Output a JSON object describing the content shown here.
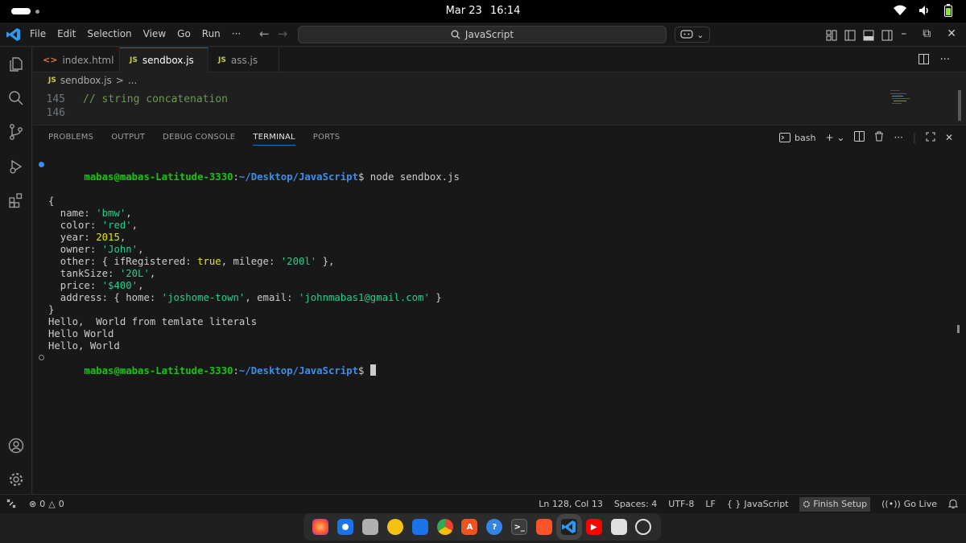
{
  "system_bar": {
    "date": "Mar 23",
    "time": "16:14",
    "tray_icons": [
      "wifi-icon",
      "volume-icon",
      "battery-icon"
    ]
  },
  "titlebar": {
    "menu": [
      "File",
      "Edit",
      "Selection",
      "View",
      "Go",
      "Run",
      "···"
    ],
    "search_text": "JavaScript",
    "accent_color": "#0078d4"
  },
  "tabs": [
    {
      "label": "index.html",
      "icon": "html-icon",
      "active": false
    },
    {
      "label": "sendbox.js",
      "icon": "js-icon",
      "active": true
    },
    {
      "label": "ass.js",
      "icon": "js-icon",
      "active": false
    }
  ],
  "breadcrumb": {
    "icon_label": "JS",
    "file": "sendbox.js",
    "separator": ">",
    "ellipsis": "..."
  },
  "editor": {
    "lines": [
      {
        "number": "145",
        "text": "// string concatenation",
        "type": "comment"
      },
      {
        "number": "146",
        "text": "",
        "type": "plain"
      }
    ]
  },
  "panel": {
    "tabs": [
      "PROBLEMS",
      "OUTPUT",
      "DEBUG CONSOLE",
      "TERMINAL",
      "PORTS"
    ],
    "active_tab": "TERMINAL",
    "shell": "bash",
    "add_label": "+",
    "more_label": "···"
  },
  "terminal": {
    "prompt_user": "mabas@mabas-Latitude-3330",
    "prompt_path": "~/Desktop/JavaScript",
    "prompt_suffix": "$",
    "command": " node sendbox.js",
    "open_brace": "{",
    "close_brace": "}",
    "obj": {
      "name_key": "  name: ",
      "name_val": "'bmw'",
      "color_key": "  color: ",
      "color_val": "'red'",
      "year_key": "  year: ",
      "year_val": "2015",
      "owner_key": "  owner: ",
      "owner_val": "'John'",
      "other_key": "  other: { ifRegistered: ",
      "other_bool": "true",
      "other_mid": ", milege: ",
      "other_val": "'200l'",
      "other_end": " },",
      "tank_key": "  tankSize: ",
      "tank_val": "'20L'",
      "price_key": "  price: ",
      "price_val": "'$400'",
      "addr_key": "  address: { home: ",
      "addr_home": "'joshome-town'",
      "addr_mid": ", email: ",
      "addr_email": "'johnmabas1@gmail.com'",
      "addr_end": " }"
    },
    "comma": ",",
    "output": [
      "Hello,  World from temlate literals",
      "Hello World",
      "Hello, World"
    ],
    "success_dot_color": "#3b8eea",
    "idle_dot_color": "#888888"
  },
  "statusbar": {
    "errors": "0",
    "warnings": "0",
    "position": "Ln 128, Col 13",
    "spaces": "Spaces: 4",
    "encoding": "UTF-8",
    "eol": "LF",
    "language": "JavaScript",
    "language_icon": "{ }",
    "finish_setup": "Finish Setup",
    "go_live": "Go Live"
  },
  "dock": {
    "apps": [
      "firefox-icon",
      "thunderbird-icon",
      "files-icon",
      "rhythmbox-icon",
      "writer-icon",
      "chrome-icon",
      "app-center-icon",
      "help-icon",
      "terminal-icon",
      "brave-icon",
      "vscode-icon",
      "youtube-icon",
      "trash-icon",
      "settings-icon"
    ]
  }
}
